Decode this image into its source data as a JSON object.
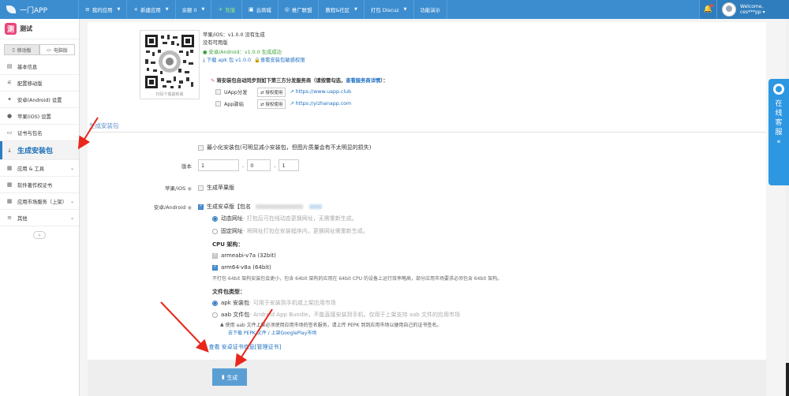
{
  "topbar": {
    "logo": "一门APP",
    "nav": [
      {
        "label": "我的应用",
        "icon": "≡",
        "caret": true
      },
      {
        "label": "新建应用",
        "icon": "+",
        "caret": true
      },
      {
        "label": "余额 0",
        "icon": "",
        "caret": true
      },
      {
        "label": "充值",
        "icon": "+",
        "caret": false,
        "green": true
      },
      {
        "label": "云商城",
        "icon": "▣",
        "caret": false
      },
      {
        "label": "推广联盟",
        "icon": "◎",
        "caret": false
      },
      {
        "label": "教程&社区",
        "icon": "",
        "caret": true
      },
      {
        "label": "打包 Discuz",
        "icon": "",
        "caret": true
      },
      {
        "label": "功能演示",
        "icon": "",
        "caret": false
      }
    ],
    "welcome": "Welcome,",
    "username": "ces***pp"
  },
  "sidebar": {
    "app_name": "测试",
    "app_icon_char": "测",
    "tab_mobile": "移动版",
    "tab_pc": "电脑版",
    "items": [
      {
        "label": "基本信息",
        "icon": "▤"
      },
      {
        "label": "配置移动版",
        "icon": "⚟"
      },
      {
        "label": "安卓(Android) 设置",
        "icon": "✦"
      },
      {
        "label": "苹果(iOS) 设置",
        "icon": ""
      },
      {
        "label": "证书与包名",
        "icon": "▭"
      },
      {
        "label": "生成安装包",
        "icon": "⇣",
        "active": true
      },
      {
        "label": "应用 & 工具",
        "icon": "▦",
        "chevron": true
      },
      {
        "label": "软件著作权证书",
        "icon": "▦"
      },
      {
        "label": "应用市场服务（上架）",
        "icon": "▦",
        "chevron": true
      },
      {
        "label": "其他",
        "icon": "≡",
        "chevron": true
      }
    ]
  },
  "package_info": {
    "qr_caption": "扫码下载最新版",
    "ios_line": "苹果/iOS：v1.0.0 没有生成",
    "ios_sub": "没有可用版",
    "android_line": "安卓/Android：v1.0.0 生成成功",
    "download_link": "下载 apk 包 v1.0.0",
    "permission_link": "查看安装包敏感权限"
  },
  "distribution": {
    "heading": "将安装包自动同步到如下第三方分发服务商（请按需勾选，",
    "heading_link": "查看服务商详情",
    "heading_end": "）：",
    "providers": [
      {
        "name": "UApp分发",
        "auth": "授权使用",
        "url": "https://www.uapp.club"
      },
      {
        "name": "App驿站",
        "auth": "授权使用",
        "url": "https://yizhanapp.com"
      }
    ]
  },
  "section_title": "生成安装包",
  "form": {
    "minimize": "最小化安装包(可明显减小安装包，但图片质量会有不太明显的损失)",
    "version_label": "版本",
    "version": [
      "1",
      "0",
      "1"
    ],
    "ios_label": "苹果/iOS",
    "ios_option": "生成苹果版",
    "android_label": "安卓/Android",
    "android_option": "生成安卓版【包名",
    "dynamic_url": "动态网址",
    "dynamic_hint": " - 打包后可在线动态更换网址，无需重新生成。",
    "fixed_url": "固定网址",
    "fixed_hint": " - 将网址打包在安装程序内，更换网址需重新生成。",
    "cpu_title": "CPU 架构：",
    "cpu_v7a": "armeabi-v7a (32bit)",
    "cpu_v8a": "arm64-v8a (64bit)",
    "cpu_note": "不打包 64bit 架构安装包会更小，包含 64bit 架构的应用在 64bit CPU 的设备上运行效率略高，部分应用市场要求必须包含 64bit 架构。",
    "file_type_title": "文件包类型：",
    "apk_option": "apk 安装包",
    "apk_hint": " - 可用于安装到手机或上架应用市场",
    "aab_option": "aab 文件包",
    "aab_hint": " - Android App Bundle，不能直接安装到手机，仅用于上架支持 aab 文件的应用市场",
    "aab_warn": "使用 aab 文件上架必须使用应用市场的签名服务，请上传 PEPK 到到应用市场以便用自己的证书签名。",
    "aab_links": "去下载 PEPK 文件 / 上架GooglePlay市场",
    "cert_link": "查看 安卓证书信息",
    "cert_manage": "[管理证书]"
  },
  "footer": {
    "generate": "生成"
  },
  "online_service": "在线客服"
}
